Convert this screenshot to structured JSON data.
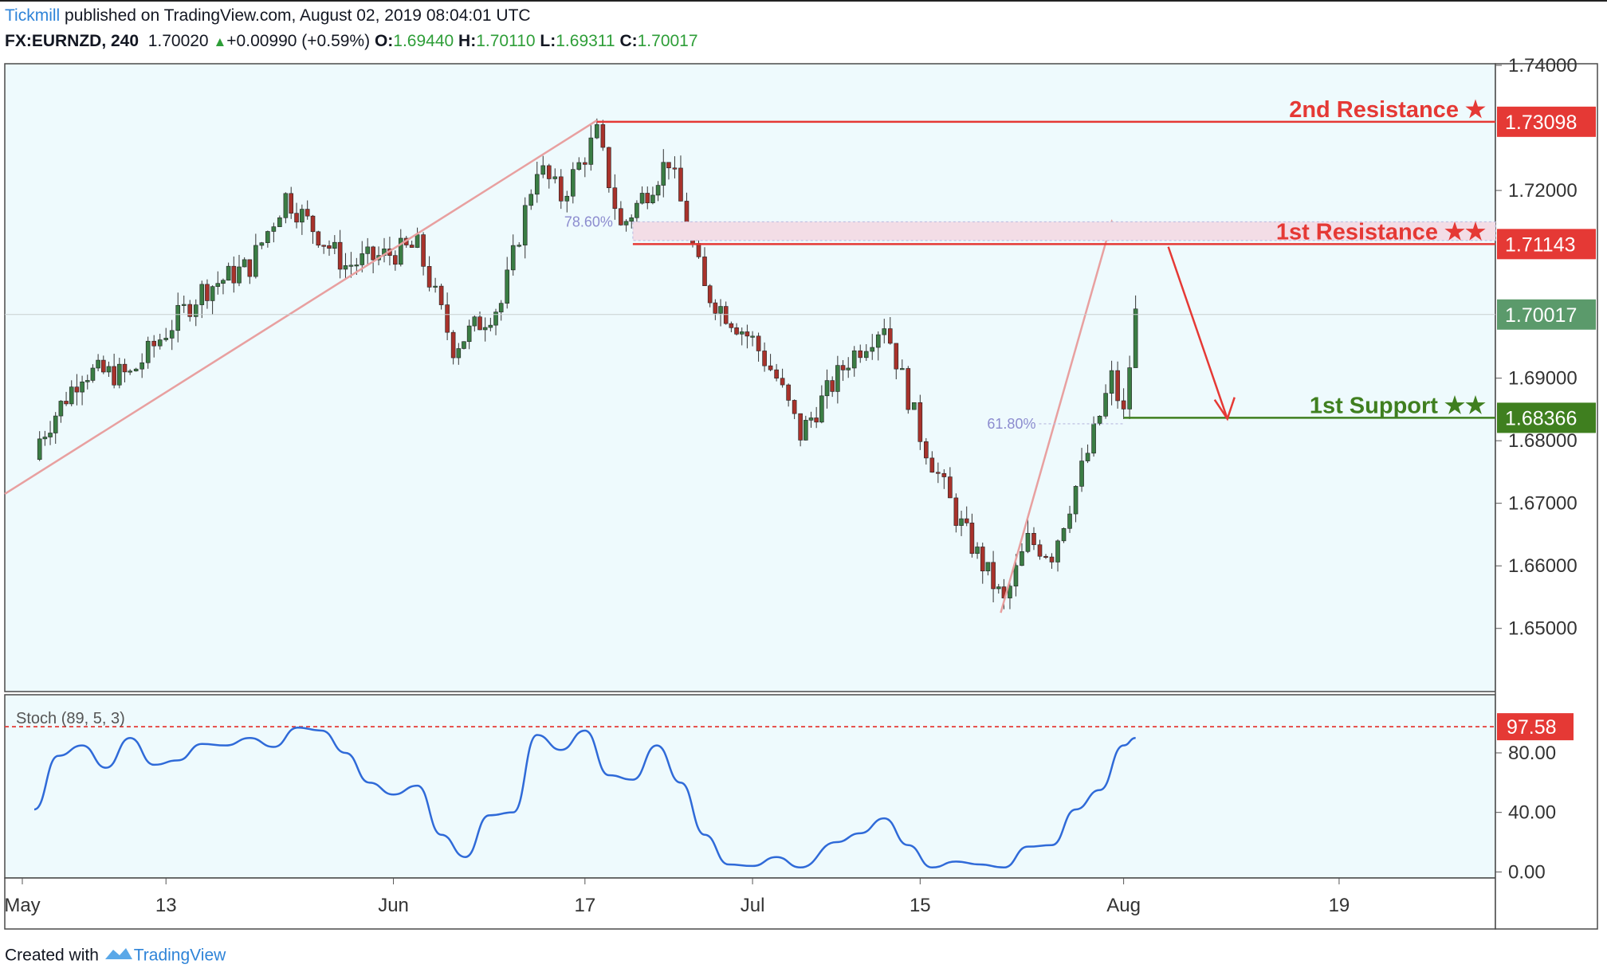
{
  "header": {
    "publisher": "Tickmill",
    "published_text": " published on TradingView.com, August 02, 2019 08:04:01 UTC",
    "symbol": "FX:EURNZD, 240",
    "last": "1.70020",
    "change_arrow": "▲",
    "change": "+0.00990 (+0.59%)",
    "o_label": "O:",
    "o_value": "1.69440",
    "h_label": "H:",
    "h_value": "1.70110",
    "l_label": "L:",
    "l_value": "1.69311",
    "c_label": "C:",
    "c_value": "1.70017"
  },
  "footer": {
    "created_text": "Created with",
    "brand": "TradingView"
  },
  "colors": {
    "background": "#eefafd",
    "up_candle": "#3a7d44",
    "down_candle": "#a8322b",
    "resistance": "#e53935",
    "support": "#3f7f1f",
    "projection": "#e8a0a0",
    "stoch_line": "#2f6ad8",
    "last_price_badge": "#5b9a6b"
  },
  "chart_data": [
    {
      "type": "candlestick",
      "symbol": "FX:EURNZD",
      "timeframe": "240",
      "ylim": [
        1.645,
        1.74
      ],
      "y_ticks": [
        "1.74000",
        "1.72000",
        "1.69000",
        "1.68000",
        "1.67000",
        "1.66000",
        "1.65000"
      ],
      "x_ticks": [
        "May",
        "13",
        "Jun",
        "17",
        "Jul",
        "15",
        "Aug",
        "19"
      ],
      "close_path": [
        {
          "date": "2019-05-02",
          "close": 1.679
        },
        {
          "date": "2019-05-06",
          "close": 1.691
        },
        {
          "date": "2019-05-10",
          "close": 1.6905
        },
        {
          "date": "2019-05-13",
          "close": 1.6975
        },
        {
          "date": "2019-05-16",
          "close": 1.704
        },
        {
          "date": "2019-05-20",
          "close": 1.708
        },
        {
          "date": "2019-05-23",
          "close": 1.719
        },
        {
          "date": "2019-05-28",
          "close": 1.708
        },
        {
          "date": "2019-06-03",
          "close": 1.711
        },
        {
          "date": "2019-06-06",
          "close": 1.695
        },
        {
          "date": "2019-06-10",
          "close": 1.702
        },
        {
          "date": "2019-06-13",
          "close": 1.724
        },
        {
          "date": "2019-06-15",
          "close": 1.719
        },
        {
          "date": "2019-06-18",
          "close": 1.729
        },
        {
          "date": "2019-06-20",
          "close": 1.714
        },
        {
          "date": "2019-06-24",
          "close": 1.725
        },
        {
          "date": "2019-06-27",
          "close": 1.704
        },
        {
          "date": "2019-07-01",
          "close": 1.696
        },
        {
          "date": "2019-07-03",
          "close": 1.69
        },
        {
          "date": "2019-07-05",
          "close": 1.681
        },
        {
          "date": "2019-07-09",
          "close": 1.693
        },
        {
          "date": "2019-07-12",
          "close": 1.699
        },
        {
          "date": "2019-07-15",
          "close": 1.681
        },
        {
          "date": "2019-07-18",
          "close": 1.668
        },
        {
          "date": "2019-07-22",
          "close": 1.654
        },
        {
          "date": "2019-07-24",
          "close": 1.664
        },
        {
          "date": "2019-07-26",
          "close": 1.662
        },
        {
          "date": "2019-07-29",
          "close": 1.678
        },
        {
          "date": "2019-07-31",
          "close": 1.69
        },
        {
          "date": "2019-08-01",
          "close": 1.684
        },
        {
          "date": "2019-08-02",
          "close": 1.7002
        }
      ],
      "levels": [
        {
          "name": "2nd Resistance ★",
          "value": "1.73098",
          "price": 1.73098
        },
        {
          "name": "1st Resistance ★★",
          "value": "1.71143",
          "price": 1.71143
        },
        {
          "name": "1st Support ★★",
          "value": "1.68366",
          "price": 1.68366
        }
      ],
      "last_price": {
        "value": "1.70017",
        "price": 1.70017
      },
      "fib_labels": [
        {
          "text": "78.60%",
          "price": 1.715
        },
        {
          "text": "61.80%",
          "price": 1.6827
        }
      ]
    },
    {
      "type": "line",
      "title": "Stoch (89, 5, 3)",
      "ylim": [
        -3,
        118
      ],
      "y_ticks": [
        "80.00",
        "40.00",
        "0.00"
      ],
      "threshold": {
        "value": "97.58",
        "y": 97.58
      },
      "series": [
        {
          "points": [
            {
              "date": "2019-05-02",
              "y": 42
            },
            {
              "date": "2019-05-04",
              "y": 78
            },
            {
              "date": "2019-05-06",
              "y": 85
            },
            {
              "date": "2019-05-08",
              "y": 70
            },
            {
              "date": "2019-05-10",
              "y": 90
            },
            {
              "date": "2019-05-12",
              "y": 72
            },
            {
              "date": "2019-05-14",
              "y": 75
            },
            {
              "date": "2019-05-16",
              "y": 86
            },
            {
              "date": "2019-05-18",
              "y": 85
            },
            {
              "date": "2019-05-20",
              "y": 90
            },
            {
              "date": "2019-05-22",
              "y": 84
            },
            {
              "date": "2019-05-24",
              "y": 97
            },
            {
              "date": "2019-05-26",
              "y": 95
            },
            {
              "date": "2019-05-28",
              "y": 80
            },
            {
              "date": "2019-05-30",
              "y": 60
            },
            {
              "date": "2019-06-01",
              "y": 52
            },
            {
              "date": "2019-06-03",
              "y": 58
            },
            {
              "date": "2019-06-05",
              "y": 25
            },
            {
              "date": "2019-06-07",
              "y": 10
            },
            {
              "date": "2019-06-09",
              "y": 38
            },
            {
              "date": "2019-06-11",
              "y": 40
            },
            {
              "date": "2019-06-13",
              "y": 92
            },
            {
              "date": "2019-06-15",
              "y": 82
            },
            {
              "date": "2019-06-17",
              "y": 95
            },
            {
              "date": "2019-06-19",
              "y": 65
            },
            {
              "date": "2019-06-21",
              "y": 62
            },
            {
              "date": "2019-06-23",
              "y": 85
            },
            {
              "date": "2019-06-25",
              "y": 60
            },
            {
              "date": "2019-06-27",
              "y": 25
            },
            {
              "date": "2019-06-29",
              "y": 5
            },
            {
              "date": "2019-07-01",
              "y": 4
            },
            {
              "date": "2019-07-03",
              "y": 10
            },
            {
              "date": "2019-07-05",
              "y": 3
            },
            {
              "date": "2019-07-08",
              "y": 20
            },
            {
              "date": "2019-07-10",
              "y": 26
            },
            {
              "date": "2019-07-12",
              "y": 36
            },
            {
              "date": "2019-07-14",
              "y": 18
            },
            {
              "date": "2019-07-16",
              "y": 3
            },
            {
              "date": "2019-07-18",
              "y": 7
            },
            {
              "date": "2019-07-20",
              "y": 5
            },
            {
              "date": "2019-07-22",
              "y": 3
            },
            {
              "date": "2019-07-24",
              "y": 17
            },
            {
              "date": "2019-07-26",
              "y": 18
            },
            {
              "date": "2019-07-28",
              "y": 42
            },
            {
              "date": "2019-07-30",
              "y": 55
            },
            {
              "date": "2019-08-01",
              "y": 85
            },
            {
              "date": "2019-08-02",
              "y": 90
            }
          ]
        }
      ]
    }
  ]
}
